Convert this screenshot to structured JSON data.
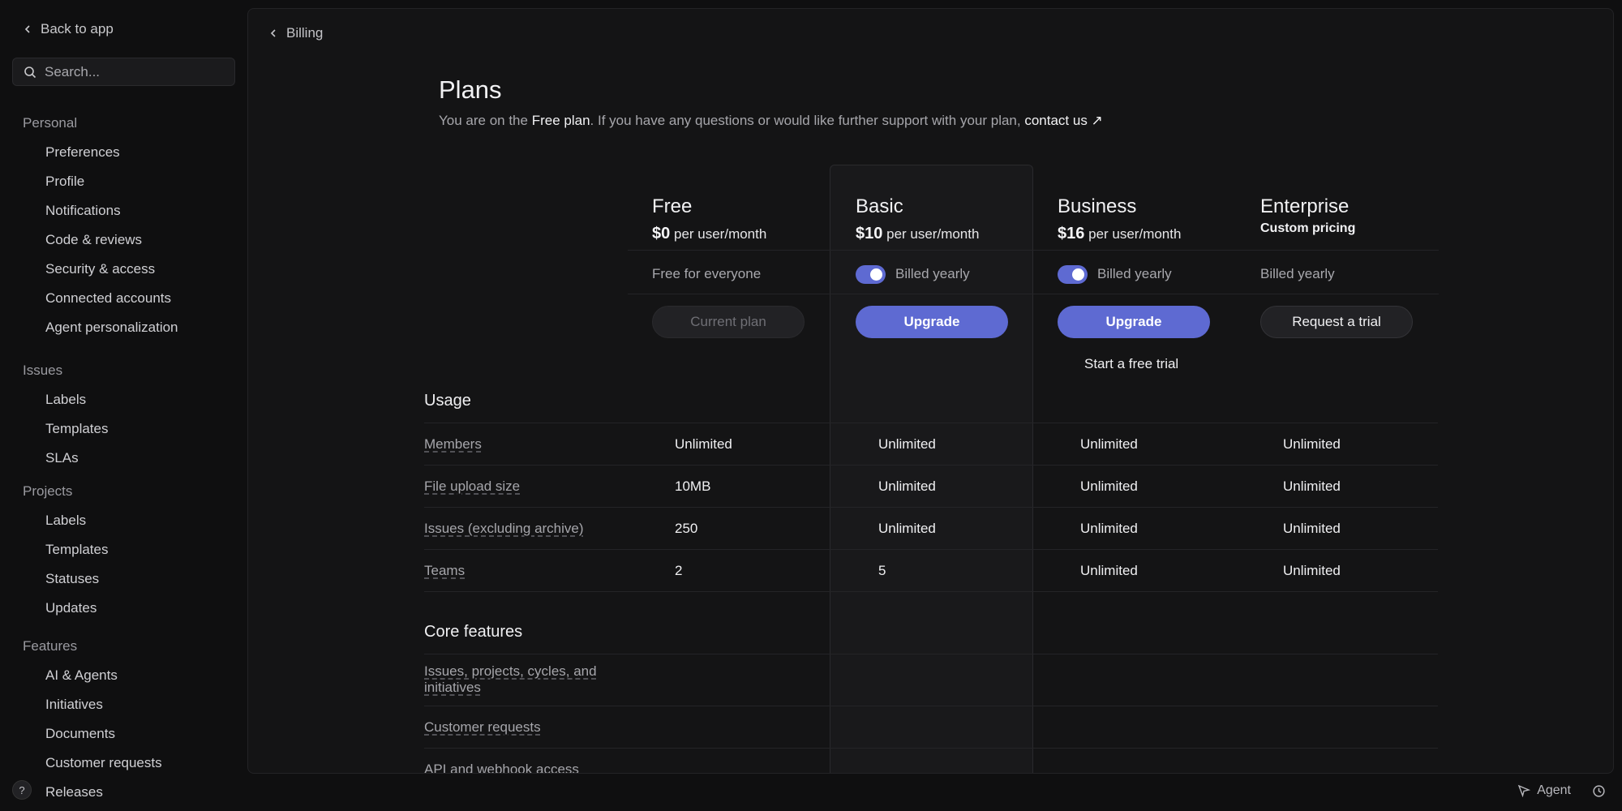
{
  "sidebar": {
    "back_label": "Back to app",
    "search_placeholder": "Search...",
    "groups": [
      {
        "header": "Personal",
        "items": [
          {
            "label": "Preferences",
            "icon": "sliders-icon"
          },
          {
            "label": "Profile",
            "icon": "user-icon"
          },
          {
            "label": "Notifications",
            "icon": "bell-icon"
          },
          {
            "label": "Code & reviews",
            "icon": "code-icon"
          },
          {
            "label": "Security & access",
            "icon": "user-shield-icon"
          },
          {
            "label": "Connected accounts",
            "icon": "gear-icon"
          },
          {
            "label": "Agent personalization",
            "icon": "cursor-icon"
          }
        ]
      },
      {
        "header": "Issues",
        "items": [
          {
            "label": "Labels",
            "icon": "tag-icon"
          },
          {
            "label": "Templates",
            "icon": "template-icon"
          },
          {
            "label": "SLAs",
            "icon": "flame-icon"
          }
        ]
      },
      {
        "header": "Projects",
        "items": [
          {
            "label": "Labels",
            "icon": "tag-icon"
          },
          {
            "label": "Templates",
            "icon": "template-icon"
          },
          {
            "label": "Statuses",
            "icon": "hexagon-icon"
          },
          {
            "label": "Updates",
            "icon": "chart-icon"
          }
        ]
      },
      {
        "header": "Features",
        "items": [
          {
            "label": "AI & Agents",
            "icon": "sparkle-icon"
          },
          {
            "label": "Initiatives",
            "icon": "rocket-icon"
          },
          {
            "label": "Documents",
            "icon": "document-icon"
          },
          {
            "label": "Customer requests",
            "icon": "requests-icon"
          },
          {
            "label": "Releases",
            "icon": "release-icon"
          }
        ]
      }
    ],
    "help_label": "?"
  },
  "main": {
    "breadcrumb": "Billing",
    "title": "Plans",
    "subtitle": {
      "prefix": "You are on the ",
      "plan": "Free plan",
      "middle": ". If you have any questions or would like further support with your plan, ",
      "link": "contact us ↗"
    },
    "plans": [
      {
        "name": "Free",
        "price": "$0",
        "unit": "per user/month",
        "billing": "Free for everyone",
        "toggle": false,
        "button": "Current plan",
        "button_style": "disabled",
        "trial": ""
      },
      {
        "name": "Basic",
        "price": "$10",
        "unit": "per user/month",
        "billing": "Billed yearly",
        "toggle": true,
        "button": "Upgrade",
        "button_style": "primary",
        "trial": ""
      },
      {
        "name": "Business",
        "price": "$16",
        "unit": "per user/month",
        "billing": "Billed yearly",
        "toggle": true,
        "button": "Upgrade",
        "button_style": "primary",
        "trial": "Start a free trial"
      },
      {
        "name": "Enterprise",
        "custom": "Custom pricing",
        "billing": "Billed yearly",
        "toggle": false,
        "button": "Request a trial",
        "button_style": "secondary",
        "trial": ""
      }
    ],
    "sections": [
      {
        "title": "Usage",
        "rows": [
          {
            "label": "Members",
            "values": [
              "Unlimited",
              "Unlimited",
              "Unlimited",
              "Unlimited"
            ]
          },
          {
            "label": "File upload size",
            "values": [
              "10MB",
              "Unlimited",
              "Unlimited",
              "Unlimited"
            ]
          },
          {
            "label": "Issues (excluding archive)",
            "values": [
              "250",
              "Unlimited",
              "Unlimited",
              "Unlimited"
            ]
          },
          {
            "label": "Teams",
            "values": [
              "2",
              "5",
              "Unlimited",
              "Unlimited"
            ]
          }
        ]
      },
      {
        "title": "Core features",
        "rows": [
          {
            "label": "Issues, projects, cycles, and initiatives",
            "values": [
              "",
              "",
              "",
              ""
            ]
          },
          {
            "label": "Customer requests",
            "values": [
              "",
              "",
              "",
              ""
            ]
          },
          {
            "label": "API and webhook access",
            "values": [
              "",
              "",
              "",
              ""
            ]
          }
        ]
      }
    ]
  },
  "footer": {
    "agent_label": "Agent",
    "history_icon": "history-icon"
  },
  "colors": {
    "accent": "#5e6ad2",
    "background": "#0f0f10",
    "panel": "#141415"
  }
}
